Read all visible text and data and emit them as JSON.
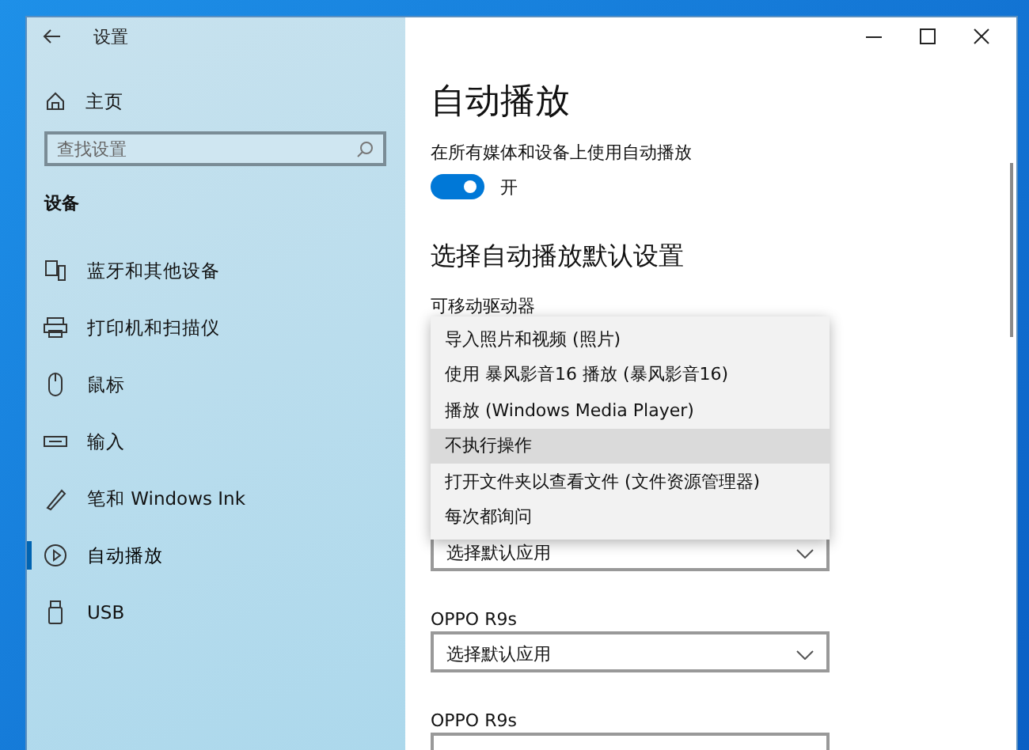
{
  "window": {
    "title": "设置"
  },
  "sidebar": {
    "home": "主页",
    "search": {
      "placeholder": "查找设置"
    },
    "section": "设备",
    "items": [
      {
        "label": "蓝牙和其他设备",
        "selected": false
      },
      {
        "label": "打印机和扫描仪",
        "selected": false
      },
      {
        "label": "鼠标",
        "selected": false
      },
      {
        "label": "输入",
        "selected": false
      },
      {
        "label": "笔和 Windows Ink",
        "selected": false
      },
      {
        "label": "自动播放",
        "selected": true
      },
      {
        "label": "USB",
        "selected": false
      }
    ]
  },
  "content": {
    "title": "自动播放",
    "toggle": {
      "label": "在所有媒体和设备上使用自动播放",
      "on": true,
      "state_text": "开"
    },
    "section": "选择自动播放默认设置",
    "dropdowns": [
      {
        "label": "可移动驱动器",
        "expanded": true,
        "options": [
          {
            "label": "导入照片和视频 (照片)",
            "selected": false
          },
          {
            "label": "使用 暴风影音16 播放 (暴风影音16)",
            "selected": false
          },
          {
            "label": "播放 (Windows Media Player)",
            "selected": false
          },
          {
            "label": "不执行操作",
            "selected": true
          },
          {
            "label": "打开文件夹以查看文件 (文件资源管理器)",
            "selected": false
          },
          {
            "label": "每次都询问",
            "selected": false
          }
        ]
      },
      {
        "value": "选择默认应用",
        "expanded": false
      },
      {
        "label": "OPPO R9s",
        "value": "选择默认应用",
        "expanded": false
      },
      {
        "label": "OPPO R9s",
        "expanded": false
      }
    ]
  }
}
